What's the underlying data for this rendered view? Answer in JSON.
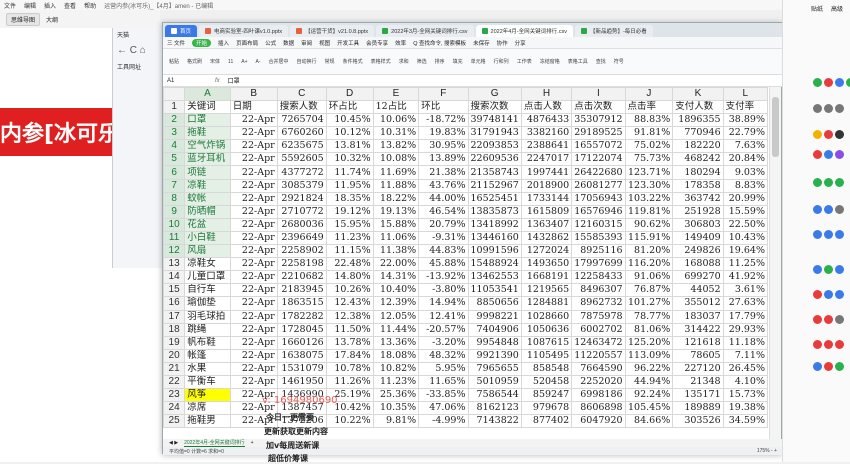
{
  "outer": {
    "menus": [
      "文件",
      "编辑",
      "插入",
      "查看",
      "帮助"
    ],
    "menu_extra": "运营内参(冰可乐)_【4月】amen - 已编辑",
    "toolbar_btn": "思维导图",
    "toolbar_item": "大纲"
  },
  "banner": {
    "text": "内参[冰可乐]"
  },
  "browser": {
    "tab": "天猫",
    "nav": "← C ⌂",
    "bookmark": "工具网址"
  },
  "window": {
    "tabs": [
      {
        "label": "首页",
        "kind": "home"
      },
      {
        "label": "电商实验室-四叶课v1.0.pptx",
        "kind": "ppt"
      },
      {
        "label": "【运营干货】v21.0.8.pptx",
        "kind": "ppt"
      },
      {
        "label": "2022年3月-全网关键词排行.csv",
        "kind": "csv"
      },
      {
        "label": "2022年4月-全网关键词排行.csv",
        "kind": "csv",
        "active": true
      },
      {
        "label": "【新品趋势】-每日必看",
        "kind": "csv"
      }
    ],
    "ribbon_menu": [
      "三 文件",
      "开始",
      "插入",
      "页面布局",
      "公式",
      "数据",
      "审阅",
      "视图",
      "开发工具",
      "会员专享",
      "效率",
      "Q 查找命令, 搜索模板",
      "未保存",
      "协作",
      "分享"
    ],
    "ribbon_tools": [
      "粘贴",
      "格式刷",
      "宋体",
      "11",
      "A+",
      "A-",
      "合并居中",
      "自动换行",
      "常规",
      "条件格式",
      "表格样式",
      "求和",
      "筛选",
      "排序",
      "填充",
      "单元格",
      "行和列",
      "工作表",
      "冻结窗格",
      "表格工具",
      "查找",
      "符号"
    ],
    "formula": {
      "cell": "A1",
      "fx": "fx",
      "value": "口罩"
    },
    "sheet_tab": "2022年4月-全网关键词排行",
    "status_left": "平均值=0  计数=6  求和=0",
    "status_right": "175% -  +"
  },
  "sheet": {
    "col_letters": [
      "",
      "A",
      "B",
      "C",
      "D",
      "E",
      "F",
      "G",
      "H",
      "I",
      "J",
      "K",
      "L"
    ],
    "headers": [
      "关键词",
      "日期",
      "搜索人数",
      "环占比",
      "12占比",
      "环比",
      "搜索次数",
      "点击人数",
      "点击次数",
      "点击率",
      "支付人数",
      "支付率"
    ],
    "rows": [
      [
        "口罩",
        "22-Apr",
        "7265704",
        "10.45%",
        "10.06%",
        "-18.72%",
        "39748141",
        "4876433",
        "35307912",
        "88.83%",
        "1896355",
        "38.89%"
      ],
      [
        "拖鞋",
        "22-Apr",
        "6760260",
        "10.12%",
        "10.31%",
        "19.83%",
        "31791943",
        "3382160",
        "29189525",
        "91.81%",
        "770946",
        "22.79%"
      ],
      [
        "空气炸锅",
        "22-Apr",
        "6235675",
        "13.81%",
        "13.82%",
        "30.95%",
        "22093853",
        "2388641",
        "16557072",
        "75.02%",
        "182220",
        "7.63%"
      ],
      [
        "蓝牙耳机",
        "22-Apr",
        "5592605",
        "10.32%",
        "10.08%",
        "13.89%",
        "22609536",
        "2247017",
        "17122074",
        "75.73%",
        "468242",
        "20.84%"
      ],
      [
        "项链",
        "22-Apr",
        "4377272",
        "11.74%",
        "11.69%",
        "21.38%",
        "21358743",
        "1997441",
        "26422680",
        "123.71%",
        "180294",
        "9.03%"
      ],
      [
        "凉鞋",
        "22-Apr",
        "3085379",
        "11.95%",
        "11.88%",
        "43.76%",
        "21152967",
        "2018900",
        "26081277",
        "123.30%",
        "178358",
        "8.83%"
      ],
      [
        "蚊帐",
        "22-Apr",
        "2921824",
        "18.35%",
        "18.22%",
        "44.00%",
        "16525451",
        "1733144",
        "17056943",
        "103.22%",
        "363742",
        "20.99%"
      ],
      [
        "防晒帽",
        "22-Apr",
        "2710772",
        "19.12%",
        "19.13%",
        "46.54%",
        "13835873",
        "1615809",
        "16576946",
        "119.81%",
        "251928",
        "15.59%"
      ],
      [
        "花盆",
        "22-Apr",
        "2680036",
        "15.95%",
        "15.88%",
        "20.79%",
        "13418992",
        "1363407",
        "12160315",
        "90.62%",
        "306803",
        "22.50%"
      ],
      [
        "小白鞋",
        "22-Apr",
        "2396649",
        "11.23%",
        "11.06%",
        "-9.31%",
        "13446160",
        "1432862",
        "15585393",
        "115.91%",
        "149409",
        "10.43%"
      ],
      [
        "风扇",
        "22-Apr",
        "2258902",
        "11.15%",
        "11.38%",
        "44.83%",
        "10991596",
        "1272024",
        "8925116",
        "81.20%",
        "249826",
        "19.64%"
      ],
      [
        "凉鞋女",
        "22-Apr",
        "2258198",
        "22.48%",
        "22.00%",
        "45.88%",
        "15488924",
        "1493650",
        "17997699",
        "116.20%",
        "168088",
        "11.25%"
      ],
      [
        "儿童口罩",
        "22-Apr",
        "2210682",
        "14.80%",
        "14.31%",
        "-13.92%",
        "13462553",
        "1668191",
        "12258433",
        "91.06%",
        "699270",
        "41.92%"
      ],
      [
        "自行车",
        "22-Apr",
        "2183945",
        "10.26%",
        "10.40%",
        "-3.80%",
        "11053541",
        "1219565",
        "8496307",
        "76.87%",
        "44052",
        "3.61%"
      ],
      [
        "瑜伽垫",
        "22-Apr",
        "1863515",
        "12.43%",
        "12.39%",
        "14.94%",
        "8850656",
        "1284881",
        "8962732",
        "101.27%",
        "355012",
        "27.63%"
      ],
      [
        "羽毛球拍",
        "22-Apr",
        "1782282",
        "12.38%",
        "12.05%",
        "12.41%",
        "9998221",
        "1028660",
        "7875978",
        "78.77%",
        "183037",
        "17.79%"
      ],
      [
        "跳绳",
        "22-Apr",
        "1728045",
        "11.50%",
        "11.44%",
        "-20.57%",
        "7404906",
        "1050636",
        "6002702",
        "81.06%",
        "314422",
        "29.93%"
      ],
      [
        "帆布鞋",
        "22-Apr",
        "1660126",
        "13.78%",
        "13.36%",
        "-3.20%",
        "9954848",
        "1087615",
        "12463472",
        "125.20%",
        "121618",
        "11.18%"
      ],
      [
        "帐篷",
        "22-Apr",
        "1638075",
        "17.84%",
        "18.08%",
        "48.32%",
        "9921390",
        "1105495",
        "11220557",
        "113.09%",
        "78605",
        "7.11%"
      ],
      [
        "水果",
        "22-Apr",
        "1531079",
        "10.78%",
        "10.82%",
        "5.95%",
        "7965655",
        "858548",
        "7664590",
        "96.22%",
        "227120",
        "26.45%"
      ],
      [
        "平衡车",
        "22-Apr",
        "1461950",
        "11.26%",
        "11.23%",
        "11.65%",
        "5010959",
        "520458",
        "2252020",
        "44.94%",
        "21348",
        "4.10%"
      ],
      [
        "风筝",
        "22-Apr",
        "1436990",
        "25.19%",
        "25.36%",
        "-33.85%",
        "7586544",
        "859247",
        "6998186",
        "92.24%",
        "135171",
        "15.73%"
      ],
      [
        "凉席",
        "22-Apr",
        "1387457",
        "10.42%",
        "10.35%",
        "47.06%",
        "8162123",
        "979678",
        "8606898",
        "105.45%",
        "189889",
        "19.38%"
      ],
      [
        "拖鞋男",
        "22-Apr",
        "1372206",
        "10.22%",
        "9.81%",
        "-4.99%",
        "7143822",
        "877402",
        "6047920",
        "84.66%",
        "303526",
        "34.59%"
      ]
    ]
  },
  "overlay": {
    "watermark": "v: 1694980690",
    "line1": "今日一更需要",
    "line2": "更新获取更新内容",
    "line3": "加v每周送新课",
    "line4": "超低价筹课"
  },
  "right": {
    "label1": "贴纸",
    "label2": "高级"
  }
}
